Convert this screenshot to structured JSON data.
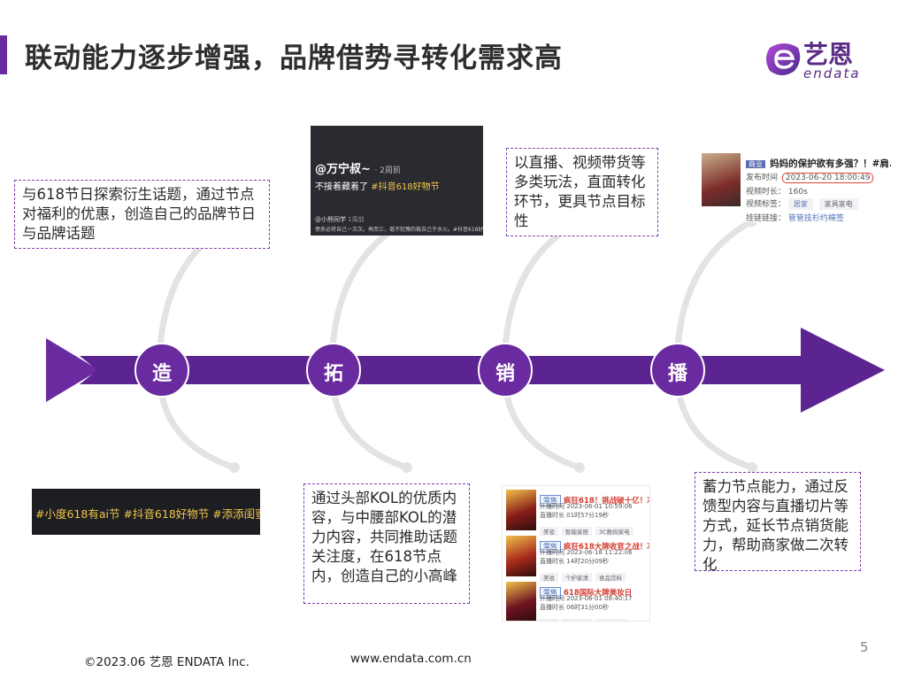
{
  "title": "联动能力逐步增强，品牌借势寻转化需求高",
  "logo": {
    "cn": "艺恩",
    "en": "endata"
  },
  "stages": [
    "造",
    "拓",
    "销",
    "播"
  ],
  "notes": {
    "zao": "与618节日探索衍生话题，通过节点对福利的优惠，创造自己的品牌节日与品牌话题",
    "tuo": "通过头部KOL的优质内容，与中腰部KOL的潜力内容，共同推助话题关注度，在618节点内，创造自己的小高峰",
    "xiao": "以直播、视频带货等多类玩法，直面转化环节，更具节点目标性",
    "bo": "蓄力节点能力，通过反馈型内容与直播切片等方式，延长节点销货能力，帮助商家做二次转化"
  },
  "shot_wanning": {
    "author": "@万宁叔~",
    "time": "· 2周前",
    "caption_plain": "不接着藏着了",
    "caption_tag": "#抖音618好物节",
    "sub_author": "@小熊同学",
    "sub_time": "1周前",
    "sub_text": "债务必将自己一次次。再而三，毫不犹豫的裁自己于水火。#抖音618好物节"
  },
  "shot_hashtags": "#小度618有ai节 #抖音618好物节 #添添闺蜜机",
  "shot_commerce": {
    "tag": "商业",
    "title": "妈妈的保护欲有多强？！#肩...",
    "publish_label": "发布时间",
    "publish_value": "2023-06-20 18:00:49",
    "duration_label": "视频时长",
    "duration_value": "160s",
    "label_label": "视频标签",
    "tags": [
      "居家",
      "家具家电"
    ],
    "link_label": "挂链链接",
    "link_value": "管管技杉约棉签"
  },
  "live_cards": [
    {
      "tag": "零售",
      "title": "疯狂618！挑战破十亿！冲",
      "start_label": "开播时间",
      "start": "2023-06-01 10:59:06",
      "dur_label": "直播时长",
      "dur": "01时57分19秒",
      "cats": [
        "美妆",
        "智能家居",
        "3C数码家电"
      ]
    },
    {
      "tag": "零售",
      "title": "疯狂618大牌收官之战！冲",
      "start_label": "开播时间",
      "start": "2023-06-18 11:22:06",
      "dur_label": "直播时长",
      "dur": "14时20分09秒",
      "cats": [
        "美妆",
        "个护家清",
        "食品饮料"
      ]
    },
    {
      "tag": "零售",
      "title": "618国际大牌美妆日",
      "start_label": "开播时间",
      "start": "2023-06-01 08:40:17",
      "dur_label": "直播时长",
      "dur": "06时31分00秒",
      "cats": [
        "美妆",
        "个护家清",
        "虚拟充值"
      ]
    }
  ],
  "footer": {
    "copyright": "©2023.06 艺恩 ENDATA Inc.",
    "url": "www.endata.com.cn",
    "page": "5"
  },
  "colors": {
    "purple": "#6a2aa0",
    "arrow": "#5c2491",
    "curve": "#e3e3e3"
  }
}
